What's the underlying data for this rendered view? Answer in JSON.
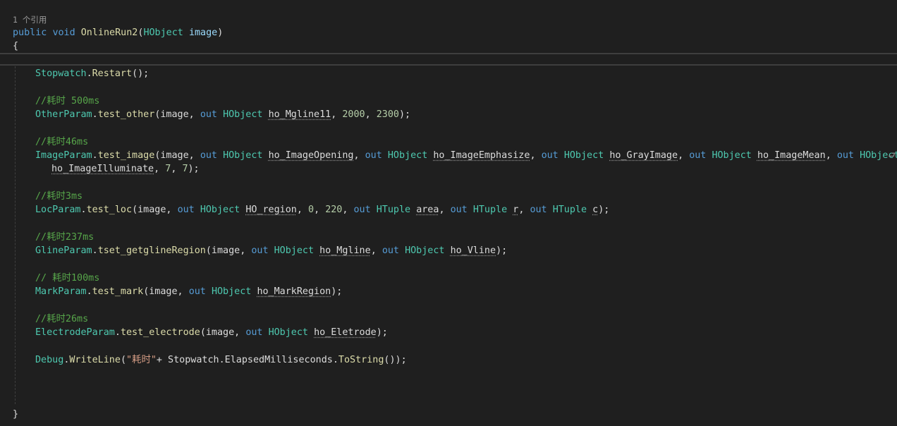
{
  "editor": {
    "reference_count": "1 个引用",
    "signature": {
      "kw1": "public",
      "kw2": "void",
      "name": "OnlineRun2",
      "open": "(",
      "ptype": "HObject",
      "pname": "image",
      "close": ")"
    },
    "open_brace": "{",
    "close_brace": "}",
    "lines": {
      "l1": {
        "cls": "Stopwatch",
        "dot": ".",
        "method": "Restart",
        "rest": "();"
      },
      "c1": "//耗时 500ms",
      "l2": {
        "cls": "OtherParam",
        "dot": ".",
        "method": "test_other",
        "p0": "(image, ",
        "out1": "out",
        "sp1": " ",
        "t1": "HObject",
        "sp2": " ",
        "v1": "ho_Mgline11",
        "c1": ", ",
        "n1": "2000",
        "c2": ", ",
        "n2": "2300",
        "end": ");"
      },
      "c2": "//耗时46ms",
      "l3": {
        "cls": "ImageParam",
        "dot": ".",
        "method": "test_image",
        "p0": "(image, ",
        "out1": "out",
        "t1": "HObject",
        "v1": "ho_ImageOpening",
        "sep1": ", ",
        "out2": "out",
        "t2": "HObject",
        "v2": "ho_ImageEmphasize",
        "sep2": ", ",
        "out3": "out",
        "t3": "HObject",
        "v3": "ho_GrayImage",
        "sep3": ", ",
        "out4": "out",
        "t4": "HObject",
        "v4": "ho_ImageMean",
        "sep4": ", ",
        "out5": "out",
        "t5": "HObject"
      },
      "l3b": {
        "v5": "ho_ImageIlluminate",
        "sep": ", ",
        "n1": "7",
        "c": ", ",
        "n2": "7",
        "end": ");"
      },
      "c3": "//耗时3ms",
      "l4": {
        "cls": "LocParam",
        "dot": ".",
        "method": "test_loc",
        "p0": "(image, ",
        "out1": "out",
        "t1": "HObject",
        "v1": "HO_region",
        "sep1": ", ",
        "n1": "0",
        "sep2": ", ",
        "n2": "220",
        "sep3": ", ",
        "out2": "out",
        "t2": "HTuple",
        "v2": "area",
        "sep4": ", ",
        "out3": "out",
        "t3": "HTuple",
        "v3": "r",
        "sep5": ", ",
        "out4": "out",
        "t4": "HTuple",
        "v4": "c",
        "end": ");"
      },
      "c4": "//耗时237ms",
      "l5": {
        "cls": "GlineParam",
        "dot": ".",
        "method": "tset_getglineRegion",
        "p0": "(image, ",
        "out1": "out",
        "t1": "HObject",
        "v1": "ho_Mgline",
        "sep1": ", ",
        "out2": "out",
        "t2": "HObject",
        "v2": "ho_Vline",
        "end": ");"
      },
      "c5": "// 耗时100ms",
      "l6": {
        "cls": "MarkParam",
        "dot": ".",
        "method": "test_mark",
        "p0": "(image, ",
        "out1": "out",
        "t1": "HObject",
        "v1": "ho_MarkRegion",
        "end": ");"
      },
      "c6": "//耗时26ms",
      "l7": {
        "cls": "ElectrodeParam",
        "dot": ".",
        "method": "test_electrode",
        "p0": "(image, ",
        "out1": "out",
        "t1": "HObject",
        "v1": "ho_Eletrode",
        "end": ");"
      },
      "l8": {
        "cls": "Debug",
        "dot": ".",
        "method": "WriteLine",
        "p0": "(",
        "str": "\"耗时\"",
        "p1": "+ Stopwatch.ElapsedMilliseconds.",
        "method2": "ToString",
        "end": "());"
      }
    },
    "colors": {
      "background": "#1f1f1f",
      "keyword": "#569cd6",
      "type": "#4ec9b0",
      "method": "#dcdcaa",
      "comment": "#57a64a",
      "string": "#d69d85",
      "number": "#b5cea8",
      "parameter": "#9cdcfe"
    },
    "wrap_indicator_icon": "word-wrap-icon"
  }
}
